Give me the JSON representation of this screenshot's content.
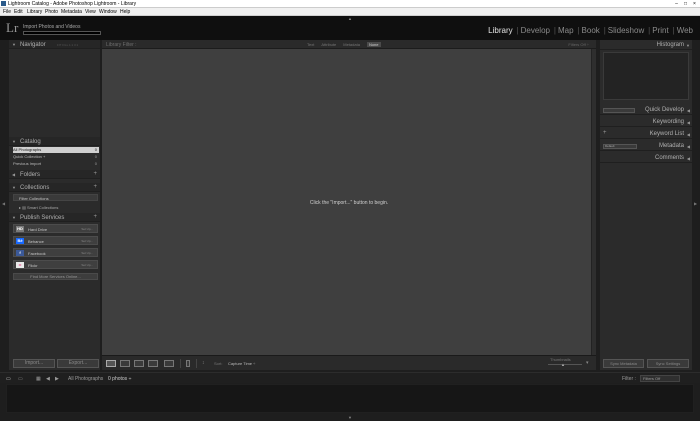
{
  "window": {
    "title": "Lightroom Catalog - Adobe Photoshop Lightroom - Library",
    "controls": [
      "–",
      "□",
      "×"
    ]
  },
  "menu": [
    "File",
    "Edit",
    "Library",
    "Photo",
    "Metadata",
    "View",
    "Window",
    "Help"
  ],
  "identity": {
    "logo": "Lr",
    "status": "Import Photos and Videos"
  },
  "modules": [
    {
      "label": "Library",
      "active": true
    },
    {
      "label": "Develop",
      "active": false
    },
    {
      "label": "Map",
      "active": false
    },
    {
      "label": "Book",
      "active": false
    },
    {
      "label": "Slideshow",
      "active": false
    },
    {
      "label": "Print",
      "active": false
    },
    {
      "label": "Web",
      "active": false
    }
  ],
  "left": {
    "navigator": {
      "label": "Navigator",
      "zoom": "FIT  FILL  1:1  3:1"
    },
    "catalog": {
      "label": "Catalog",
      "items": [
        {
          "label": "All Photographs",
          "count": "0",
          "selected": true
        },
        {
          "label": "Quick Collection +",
          "count": "0",
          "selected": false
        },
        {
          "label": "Previous Import",
          "count": "0",
          "selected": false
        }
      ]
    },
    "folders": {
      "label": "Folders"
    },
    "collections": {
      "label": "Collections",
      "filter": "Filter Collections",
      "smart": "Smart Collections"
    },
    "publish": {
      "label": "Publish Services",
      "services": [
        {
          "label": "Hard Drive",
          "action": "Set Up...",
          "icon": "HD",
          "color": "#7a7a7a"
        },
        {
          "label": "Behance",
          "action": "Set Up...",
          "icon": "Bē",
          "color": "#1769ff"
        },
        {
          "label": "Facebook",
          "action": "Set Up...",
          "icon": "f",
          "color": "#3b5998"
        },
        {
          "label": "Flickr",
          "action": "Set Up...",
          "icon": "••",
          "color": "#eaeaea"
        }
      ],
      "find_more": "Find More Services Online..."
    },
    "import_btn": "Import...",
    "export_btn": "Export..."
  },
  "center": {
    "filter_title": "Library Filter :",
    "filter_options": [
      {
        "label": "Text",
        "active": false
      },
      {
        "label": "Attribute",
        "active": false
      },
      {
        "label": "Metadata",
        "active": false
      },
      {
        "label": "None",
        "active": true
      }
    ],
    "filters_off": "Filters Off ÷",
    "empty_message": "Click the \"Import...\" button to begin.",
    "sort_label": "Sort:",
    "sort_value": "Capture Time ÷",
    "thumbnails_label": "Thumbnails"
  },
  "right": {
    "panels": [
      "Histogram",
      "Quick Develop",
      "Keywording",
      "Keyword List",
      "Metadata",
      "Comments"
    ],
    "metadata_preset": "Default",
    "sync_metadata": "Sync Metadata",
    "sync_settings": "Sync Settings"
  },
  "filmstrip": {
    "path": "All Photographs",
    "count": "0 photos ÷",
    "filter_label": "Filter :",
    "filter_value": "Filters Off"
  }
}
